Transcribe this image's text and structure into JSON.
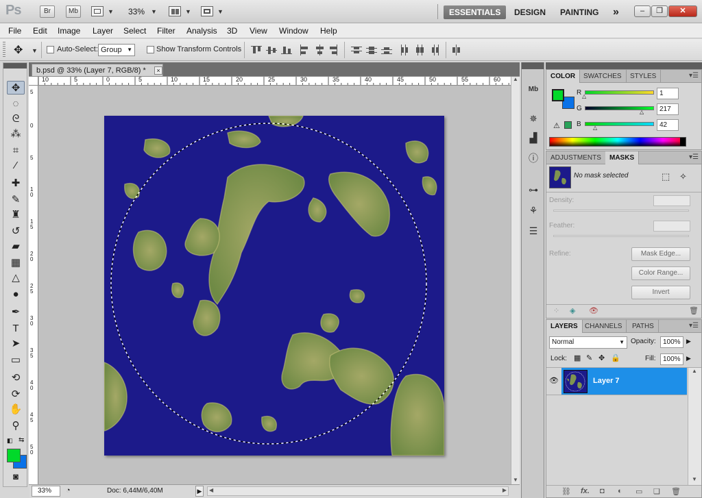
{
  "appbar": {
    "logo": "Ps",
    "bridge_label": "Br",
    "minibridge_label": "Mb",
    "zoom_level": "33%",
    "workspaces": [
      "ESSENTIALS",
      "DESIGN",
      "PAINTING"
    ],
    "more_glyph": "»",
    "active_workspace": "ESSENTIALS"
  },
  "menubar": {
    "items": [
      "File",
      "Edit",
      "Image",
      "Layer",
      "Select",
      "Filter",
      "Analysis",
      "3D",
      "View",
      "Window",
      "Help"
    ]
  },
  "options": {
    "auto_select_label": "Auto-Select:",
    "auto_select_value": "Group",
    "transform_controls_label": "Show Transform Controls"
  },
  "document": {
    "tab_title": "b.psd @ 33% (Layer 7, RGB/8) *",
    "close_glyph": "×",
    "ruler_h_labels": [
      "10",
      "5",
      "0",
      "5",
      "10",
      "15",
      "20",
      "25",
      "30",
      "35",
      "40",
      "45",
      "50",
      "55",
      "60"
    ],
    "ruler_v_labels": [
      "5",
      "0",
      "5",
      "1 0",
      "1 5",
      "2 0",
      "2 5",
      "3 0",
      "3 5",
      "4 0",
      "4 5",
      "5 0"
    ],
    "status_zoom": "33%",
    "status_doc": "Doc: 6,44M/6,40M"
  },
  "color_panel": {
    "tabs": [
      "COLOR",
      "SWATCHES",
      "STYLES"
    ],
    "r_label": "R",
    "g_label": "G",
    "b_label": "B",
    "r_value": "1",
    "g_value": "217",
    "b_value": "42",
    "foreground": "#01d92a",
    "background": "#0a72e8"
  },
  "adjustments_panel": {
    "tabs": [
      "ADJUSTMENTS",
      "MASKS"
    ],
    "mask_status": "No mask selected",
    "density_label": "Density:",
    "feather_label": "Feather:",
    "refine_label": "Refine:",
    "mask_edge_button": "Mask Edge...",
    "color_range_button": "Color Range...",
    "invert_button": "Invert"
  },
  "layers_panel": {
    "tabs": [
      "LAYERS",
      "CHANNELS",
      "PATHS"
    ],
    "blend_mode": "Normal",
    "opacity_label": "Opacity:",
    "opacity_value": "100%",
    "lock_label": "Lock:",
    "fill_label": "Fill:",
    "fill_value": "100%",
    "layers": [
      {
        "name": "Layer 7",
        "selected": true
      }
    ]
  },
  "colors": {
    "accent_selected_layer": "#1e8fe8",
    "canvas_ocean": "#1c1a8a",
    "land": "#8a9a55"
  }
}
